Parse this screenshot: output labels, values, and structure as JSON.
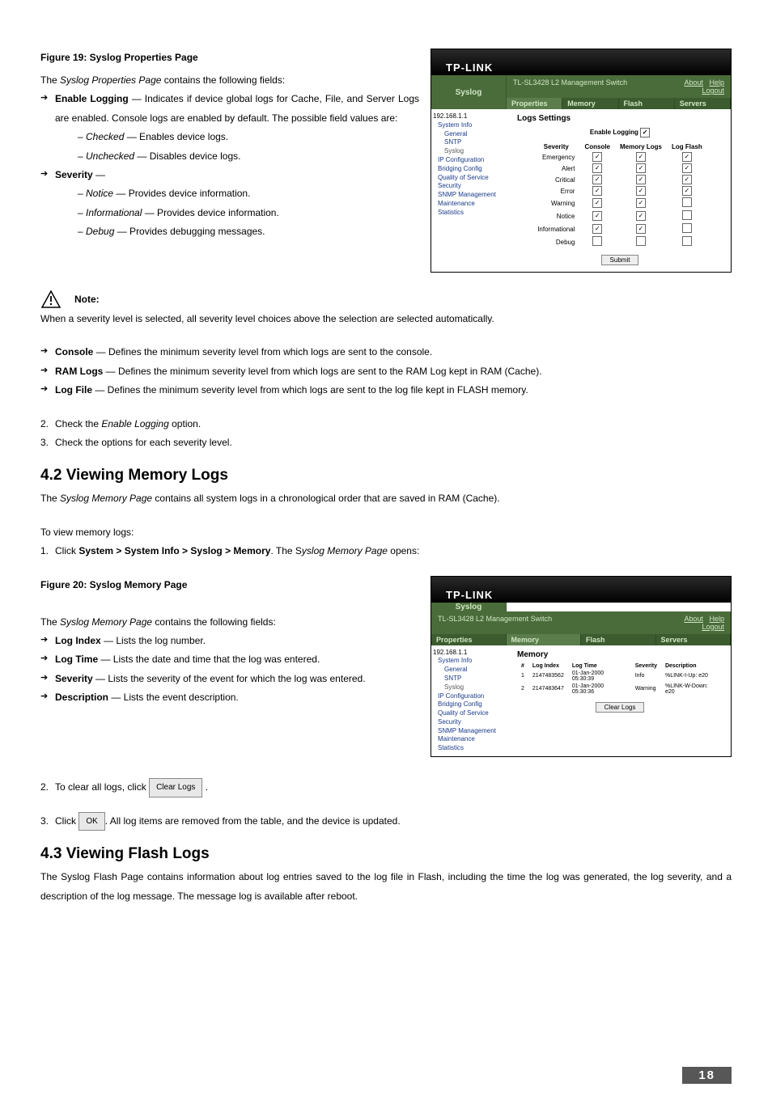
{
  "fig19_caption": "Figure 19: Syslog Properties Page",
  "intro19": "The Syslog Properties Page contains the following fields:",
  "enable_logging_item": "Enable Logging — Indicates if device global logs for Cache, File, and Server Logs are enabled. Console logs are enabled by default. The possible field values are:",
  "enable_logging_label": "Enable Logging",
  "checked_line": "– Checked — Enables device logs.",
  "unchecked_line": "– Unchecked — Disables device logs.",
  "severity_item": "Severity —",
  "severity_label": "Severity",
  "sev_notice": "– Notice — Provides device information.",
  "sev_info": "– Informational — Provides device information.",
  "sev_debug": "– Debug — Provides debugging messages.",
  "note_label": "Note:",
  "note_text": "When a severity level is selected, all severity level choices above the selection are selected automatically.",
  "console_li_label": "Console",
  "console_li": " — Defines the minimum severity level from which logs are sent to the console.",
  "ram_li_label": "RAM Logs",
  "ram_li": " — Defines the minimum severity level from which logs are sent to the RAM Log kept in RAM (Cache).",
  "file_li_label": "Log File",
  "file_li": " — Defines the minimum severity level from which logs are sent to the log file kept in FLASH memory.",
  "step2": "Check the Enable Logging option.",
  "step3": "Check the options for each severity level.",
  "sec42": "4.2  Viewing Memory Logs",
  "mem_intro": "The Syslog Memory Page contains all system logs in a chronological order that are saved in RAM (Cache).",
  "mem_view": "To view memory logs:",
  "mem_click": "Click System > System Info > Syslog > Memory. The Syslog Memory Page opens:",
  "mem_click_prefix": "Click ",
  "mem_click_bold": "System > System Info > Syslog > Memory",
  "mem_click_suffix": ". The Syslog Memory Page opens:",
  "fig20_caption": "Figure 20: Syslog Memory Page",
  "intro20": "The Syslog Memory Page contains the following fields:",
  "li_logindex_label": "Log Index",
  "li_logindex": " — Lists the log number.",
  "li_logtime_label": "Log Time",
  "li_logtime": " — Lists the date and time that the log was entered.",
  "li_sev_label": "Severity",
  "li_sev": " — Lists the severity of the event for which the log was entered.",
  "li_desc_label": "Description",
  "li_desc": " — Lists the event description.",
  "clear_step_pre": "To clear all logs, click",
  "clear_step_post": ".",
  "clear_btn": "Clear Logs",
  "ok_btn": "OK",
  "ok_step_pre": "Click",
  "ok_step_post": ". All log items are removed from the table, and the device is updated.",
  "sec43": "4.3  Viewing Flash Logs",
  "flash_intro": "The Syslog Flash Page contains information about log entries saved to the log file in Flash, including the time the log was generated, the log severity, and a description of the log message. The message log is available after reboot.",
  "page_number": "18",
  "shot1": {
    "brand": "TP-LINK",
    "syslog": "Syslog",
    "mgmt": "TL-SL3428 L2 Management Switch",
    "about": "About",
    "help": "Help",
    "logout": "Logout",
    "tabs": [
      "Properties",
      "Memory",
      "Flash",
      "Servers"
    ],
    "tree": {
      "ip": "192.168.1.1",
      "items": [
        "System Info",
        "General",
        "SNTP",
        "Syslog",
        "IP Configuration",
        "Bridging Config",
        "Quality of Service",
        "Security",
        "SNMP Management",
        "Maintenance",
        "Statistics"
      ]
    },
    "settings": "Logs Settings",
    "enable": "Enable Logging",
    "headers": [
      "Severity",
      "Console",
      "Memory Logs",
      "Log Flash"
    ],
    "rows": [
      {
        "label": "Emergency",
        "c": true,
        "m": true,
        "f": true
      },
      {
        "label": "Alert",
        "c": true,
        "m": true,
        "f": true
      },
      {
        "label": "Critical",
        "c": true,
        "m": true,
        "f": true
      },
      {
        "label": "Error",
        "c": true,
        "m": true,
        "f": true
      },
      {
        "label": "Warning",
        "c": true,
        "m": true,
        "f": false
      },
      {
        "label": "Notice",
        "c": true,
        "m": true,
        "f": false
      },
      {
        "label": "Informational",
        "c": true,
        "m": true,
        "f": false
      },
      {
        "label": "Debug",
        "c": false,
        "m": false,
        "f": false
      }
    ],
    "submit": "Submit"
  },
  "shot2": {
    "brand": "TP-LINK",
    "syslog": "Syslog",
    "mgmt": "TL-SL3428 L2 Management Switch",
    "about": "About",
    "help": "Help",
    "logout": "Logout",
    "tabs": [
      "Properties",
      "Memory",
      "Flash",
      "Servers"
    ],
    "title": "Memory",
    "headers": [
      "#",
      "Log Index",
      "Log Time",
      "Severity",
      "Description"
    ],
    "rows": [
      {
        "n": "1",
        "idx": "2147483562",
        "time": "01-Jan-2000 05:30:39",
        "sev": "Info",
        "desc": "%LINK-I-Up: e20"
      },
      {
        "n": "2",
        "idx": "2147483647",
        "time": "01-Jan-2000 05:30:36",
        "sev": "Warning",
        "desc": "%LINK-W-Down: e20"
      }
    ],
    "clear": "Clear Logs"
  }
}
